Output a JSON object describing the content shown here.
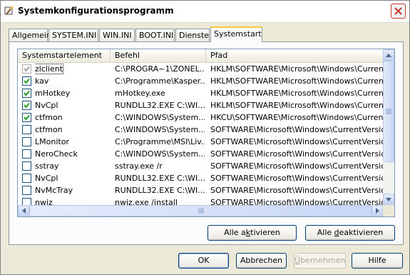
{
  "window": {
    "title": "Systemkonfigurationsprogramm",
    "accent": "#0a246a",
    "close_color": "#c0392b"
  },
  "tabs": [
    {
      "label": "Allgemein",
      "active": false
    },
    {
      "label": "SYSTEM.INI",
      "active": false
    },
    {
      "label": "WIN.INI",
      "active": false
    },
    {
      "label": "BOOT.INI",
      "active": false
    },
    {
      "label": "Dienste",
      "active": false
    },
    {
      "label": "Systemstart",
      "active": true
    }
  ],
  "listview": {
    "columns": [
      "Systemstartelement",
      "Befehl",
      "Pfad"
    ],
    "rows": [
      {
        "checked": true,
        "disabled": true,
        "selected": true,
        "name": "zlclient",
        "command": "C:\\PROGRA~1\\ZONEL...",
        "path": "HKLM\\SOFTWARE\\Microsoft\\Windows\\CurrentVer..."
      },
      {
        "checked": true,
        "disabled": false,
        "selected": false,
        "name": "kav",
        "command": "C:\\Programme\\Kasper...",
        "path": "HKLM\\SOFTWARE\\Microsoft\\Windows\\CurrentVer..."
      },
      {
        "checked": true,
        "disabled": false,
        "selected": false,
        "name": "mHotkey",
        "command": "mHotkey.exe",
        "path": "HKLM\\SOFTWARE\\Microsoft\\Windows\\CurrentVer..."
      },
      {
        "checked": true,
        "disabled": false,
        "selected": false,
        "name": "NvCpl",
        "command": "RUNDLL32.EXE C:\\WI...",
        "path": "HKLM\\SOFTWARE\\Microsoft\\Windows\\CurrentVer..."
      },
      {
        "checked": true,
        "disabled": false,
        "selected": false,
        "name": "ctfmon",
        "command": "C:\\WINDOWS\\System...",
        "path": "HKCU\\SOFTWARE\\Microsoft\\Windows\\CurrentVer..."
      },
      {
        "checked": false,
        "disabled": false,
        "selected": false,
        "name": "ctfmon",
        "command": "C:\\WINDOWS\\System...",
        "path": "SOFTWARE\\Microsoft\\Windows\\CurrentVersion\\Ru"
      },
      {
        "checked": false,
        "disabled": false,
        "selected": false,
        "name": "LMonitor",
        "command": "C:\\Programme\\MSI\\Liv...",
        "path": "SOFTWARE\\Microsoft\\Windows\\CurrentVersion\\Ru"
      },
      {
        "checked": false,
        "disabled": false,
        "selected": false,
        "name": "NeroCheck",
        "command": "C:\\WINDOWS\\System...",
        "path": "SOFTWARE\\Microsoft\\Windows\\CurrentVersion\\Ru"
      },
      {
        "checked": false,
        "disabled": false,
        "selected": false,
        "name": "sstray",
        "command": "sstray.exe /r",
        "path": "SOFTWARE\\Microsoft\\Windows\\CurrentVersion\\Ru"
      },
      {
        "checked": false,
        "disabled": false,
        "selected": false,
        "name": "NvCpl",
        "command": "RUNDLL32.EXE C:\\WI...",
        "path": "SOFTWARE\\Microsoft\\Windows\\CurrentVersion\\Ru"
      },
      {
        "checked": false,
        "disabled": false,
        "selected": false,
        "name": "NvMcTray",
        "command": "RUNDLL32.EXE C:\\WI...",
        "path": "SOFTWARE\\Microsoft\\Windows\\CurrentVersion\\Ru"
      },
      {
        "checked": false,
        "disabled": false,
        "selected": false,
        "name": "nwiz",
        "command": "nwiz.exe /install",
        "path": "SOFTWARE\\Microsoft\\Windows\\CurrentVersion\\Ru"
      }
    ]
  },
  "actions": {
    "enable_all": "Alle aktivieren",
    "disable_all": "Alle deaktivieren"
  },
  "dialog_buttons": {
    "ok": "OK",
    "cancel": "Abbrechen",
    "apply": "Übernehmen",
    "help": "Hilfe"
  }
}
